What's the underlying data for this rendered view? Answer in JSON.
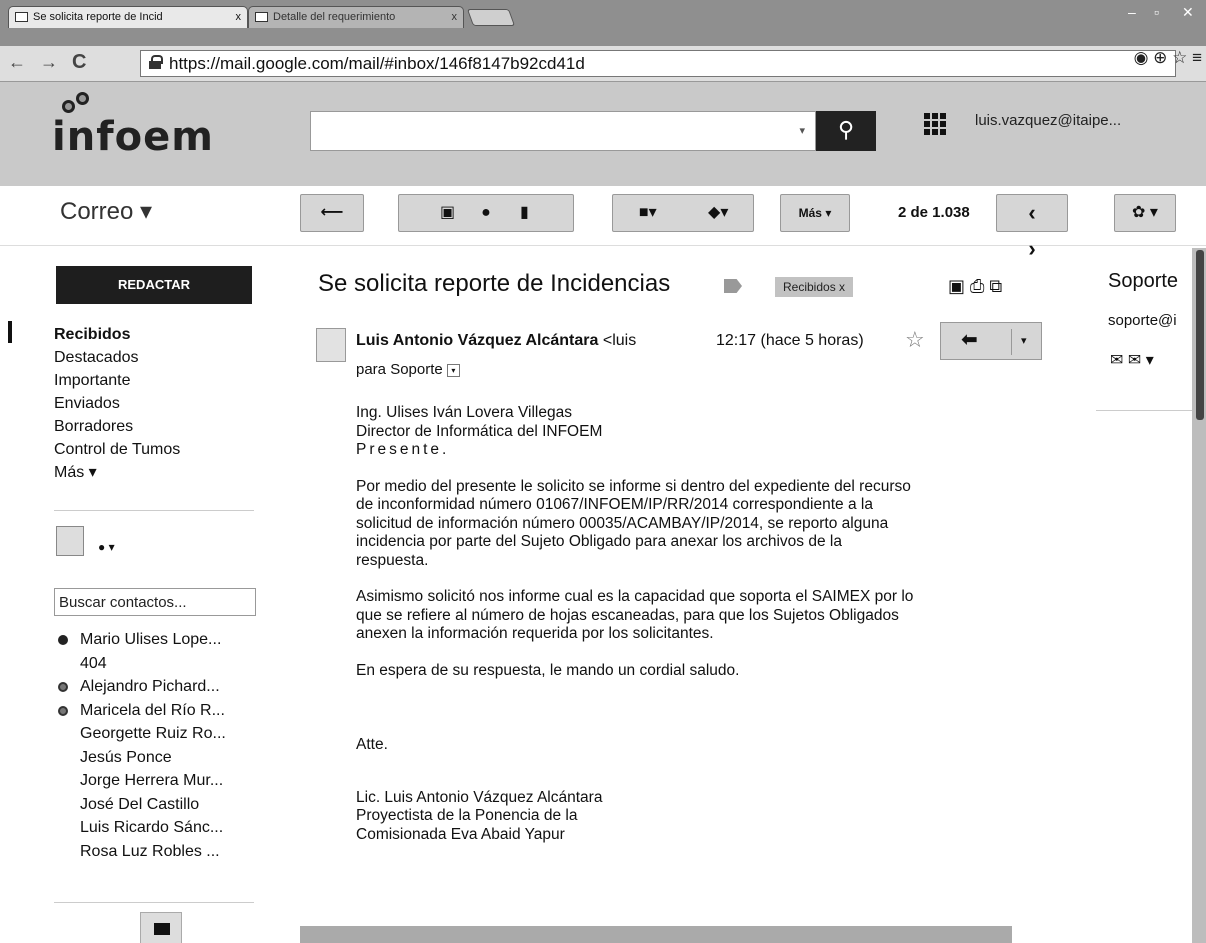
{
  "browser": {
    "tabs": [
      {
        "label": "Se solicita reporte de Incid",
        "close": "x"
      },
      {
        "label": "Detalle del requerimiento",
        "close": "x"
      }
    ],
    "url": "https://mail.google.com/mail/#inbox/146f8147b92cd41d",
    "omni_icons": "◉ ⊕ ☆ ≡"
  },
  "header": {
    "logo": "infoem",
    "search_placeholder": "",
    "search_drop": "▾",
    "search_icon": "⚲",
    "user": "luis.vazquez@itaipe..."
  },
  "toolbar": {
    "app_title": "Correo ▾",
    "reply_icon": "⟵",
    "archive_icon": "▣",
    "spam_icon": "●",
    "delete_icon": "▮",
    "move_icon": "■▾",
    "label_icon": "◆▾",
    "more": "Más ▾",
    "count": "2 de 1.038",
    "prev": "‹",
    "next": "›",
    "settings": "✿ ▾"
  },
  "sidebar": {
    "compose": "REDACTAR",
    "folders": [
      "Recibidos",
      "Destacados",
      "Importante",
      "Enviados",
      "Borradores",
      "Control de Tumos",
      "Más ▾"
    ],
    "status": "● ▾",
    "contact_search": "Buscar contactos...",
    "contacts": [
      {
        "name": "Mario Ulises Lope...",
        "sub": "404",
        "status": "online"
      },
      {
        "name": "Alejandro Pichard...",
        "sub": "",
        "status": "away"
      },
      {
        "name": "Maricela del Río R...",
        "sub": "",
        "status": "away"
      },
      {
        "name": "Georgette Ruiz Ro...",
        "sub": "",
        "status": "none"
      },
      {
        "name": "Jesús Ponce",
        "sub": "",
        "status": "none"
      },
      {
        "name": "Jorge Herrera Mur...",
        "sub": "",
        "status": "none"
      },
      {
        "name": "José Del Castillo",
        "sub": "",
        "status": "none"
      },
      {
        "name": "Luis Ricardo Sánc...",
        "sub": "",
        "status": "none"
      },
      {
        "name": "Rosa Luz Robles ...",
        "sub": "",
        "status": "none"
      }
    ]
  },
  "message": {
    "subject": "Se solicita reporte de Incidencias",
    "label_chip": "Recibidos x",
    "subject_icons": "▣ ⎙ ⧉",
    "sender_name": "Luis Antonio Vázquez Alcántara",
    "sender_email": "<luis",
    "time": "12:17 (hace 5 horas)",
    "star": "☆",
    "reply": "⬅",
    "reply_drop": "▾",
    "to": "para Soporte",
    "to_caret": "▾",
    "body": {
      "p1": "Ing. Ulises Iván Lovera Villegas\nDirector de Informática del INFOEM",
      "presente": "Presente.",
      "p2": "Por medio del presente le solicito se informe si dentro del expediente del recurso\nde inconformidad número 01067/INFOEM/IP/RR/2014 correspondiente a la\nsolicitud de información número  00035/ACAMBAY/IP/2014, se reporto alguna\nincidencia por parte del Sujeto Obligado para anexar los archivos de la\nrespuesta.",
      "p3": "Asimismo solicitó nos informe cual es la capacidad que soporta el SAIMEX por lo\nque se refiere al número de hojas escaneadas, para que los Sujetos Obligados\nanexen la información requerida por los solicitantes.",
      "p4": "En espera de su respuesta, le mando un cordial saludo.",
      "p5": "Atte.",
      "p6": "Lic. Luis Antonio Vázquez Alcántara\nProyectista de la Ponencia de la\nComisionada Eva Abaid Yapur"
    }
  },
  "right_pane": {
    "name": "Soporte",
    "email": "soporte@i",
    "icons": "✉ ✉ ▾"
  }
}
